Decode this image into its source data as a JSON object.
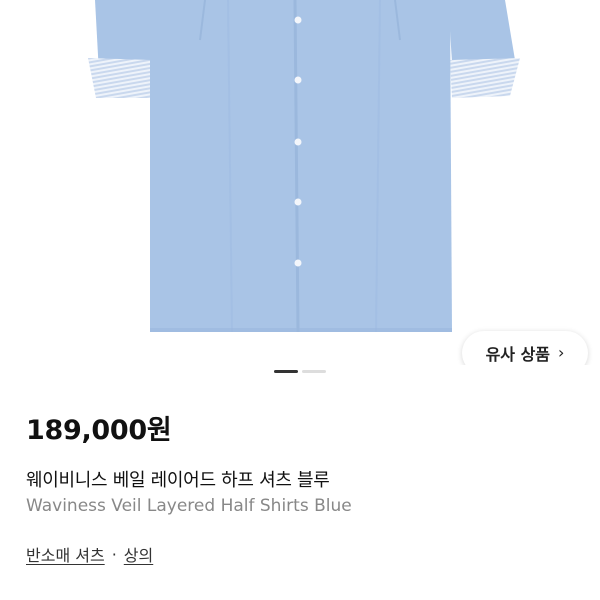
{
  "product": {
    "image_alt": "shirt-image",
    "similar_button_label": "유사 상품",
    "similar_button_icon": "chevron-right-icon",
    "pager": {
      "total": 2,
      "active_index": 0
    },
    "price": "189,000원",
    "name_ko": "웨이비니스 베일 레이어드 하프 셔츠 블루",
    "name_en": "Waviness Veil Layered Half Shirts Blue",
    "category": {
      "primary": "반소매 셔츠",
      "separator": "·",
      "secondary": "상의"
    }
  },
  "colors": {
    "shirt": "#a9c4e6",
    "shirt_shadow": "#9bb8dd",
    "cuff_stripe": "#d9e4f3",
    "text_muted": "#888888"
  }
}
